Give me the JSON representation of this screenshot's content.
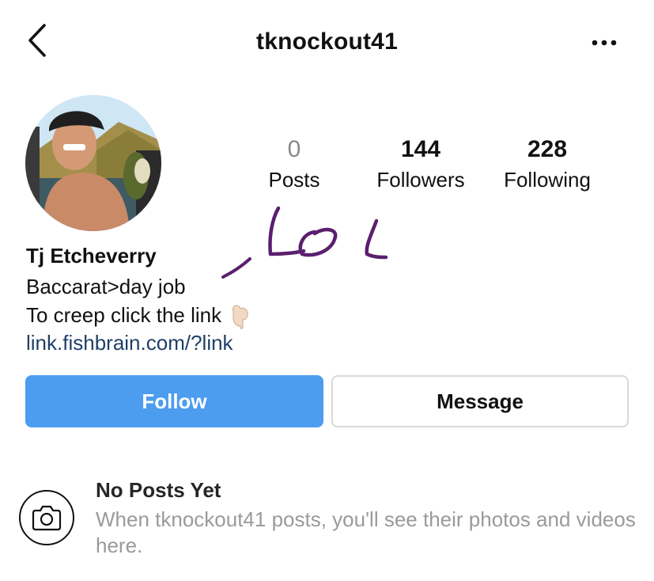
{
  "header": {
    "username": "tknockout41",
    "back_icon": "chevron-left-icon",
    "more_icon": "ellipsis-icon"
  },
  "profile": {
    "stats": [
      {
        "value": "0",
        "label": "Posts"
      },
      {
        "value": "144",
        "label": "Followers"
      },
      {
        "value": "228",
        "label": "Following"
      }
    ],
    "name": "Tj Etcheverry",
    "bio_line1": "Baccarat>day job",
    "bio_line2": "To creep click the link",
    "link": "link.fishbrain.com/?link"
  },
  "annotation": {
    "handwritten_text": "LOL",
    "ink_color": "#5a1f6e"
  },
  "actions": {
    "follow_label": "Follow",
    "message_label": "Message",
    "follow_color": "#4c9cf0"
  },
  "empty_state": {
    "icon": "camera-icon",
    "title": "No Posts Yet",
    "description": "When tknockout41 posts, you'll see their photos and videos here."
  }
}
